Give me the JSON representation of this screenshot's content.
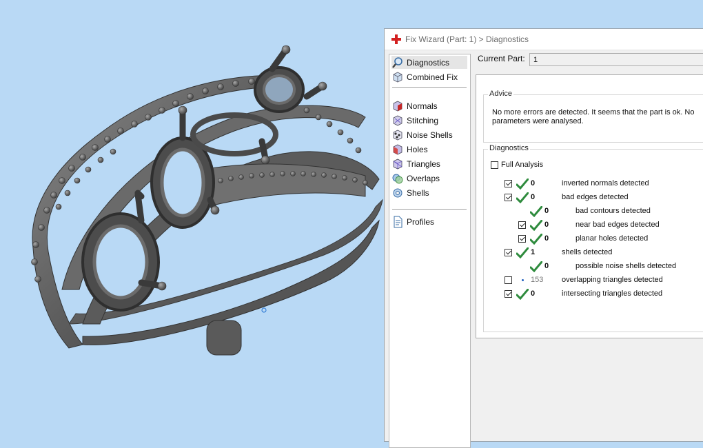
{
  "window": {
    "title": "Fix Wizard (Part: 1) > Diagnostics"
  },
  "nav": {
    "items": [
      {
        "label": "Diagnostics",
        "icon": "magnifier-icon",
        "selected": true
      },
      {
        "label": "Combined Fix",
        "icon": "cube-icon"
      },
      {
        "label": "Normals",
        "icon": "normals-cube-icon"
      },
      {
        "label": "Stitching",
        "icon": "stitching-cube-icon"
      },
      {
        "label": "Noise Shells",
        "icon": "noise-shells-icon"
      },
      {
        "label": "Holes",
        "icon": "holes-cube-icon"
      },
      {
        "label": "Triangles",
        "icon": "triangles-cube-icon"
      },
      {
        "label": "Overlaps",
        "icon": "overlaps-icon"
      },
      {
        "label": "Shells",
        "icon": "shells-icon"
      },
      {
        "label": "Profiles",
        "icon": "profiles-document-icon"
      }
    ]
  },
  "current_part": {
    "label": "Current Part:",
    "value": "1"
  },
  "advice": {
    "title": "Advice",
    "line1": "No more errors are detected. It seems that the part is ok. No",
    "line2": "parameters were analysed."
  },
  "diagnostics": {
    "title": "Diagnostics",
    "full_analysis_label": "Full Analysis",
    "full_analysis_checked": false,
    "rows": [
      {
        "checkbox": true,
        "checked": true,
        "status": "ok",
        "count": "0",
        "label": "inverted normals detected",
        "indent": 0
      },
      {
        "checkbox": true,
        "checked": true,
        "status": "ok",
        "count": "0",
        "label": "bad edges detected",
        "indent": 0
      },
      {
        "checkbox": false,
        "checked": false,
        "status": "ok",
        "count": "0",
        "label": "bad contours detected",
        "indent": 1
      },
      {
        "checkbox": true,
        "checked": true,
        "status": "ok",
        "count": "0",
        "label": "near bad edges detected",
        "indent": 1
      },
      {
        "checkbox": true,
        "checked": true,
        "status": "ok",
        "count": "0",
        "label": "planar holes detected",
        "indent": 1
      },
      {
        "checkbox": true,
        "checked": true,
        "status": "ok",
        "count": "1",
        "label": "shells detected",
        "indent": 0
      },
      {
        "checkbox": false,
        "checked": false,
        "status": "ok",
        "count": "0",
        "label": "possible noise shells detected",
        "indent": 1
      },
      {
        "checkbox": true,
        "checked": false,
        "status": "not-run",
        "count": "153",
        "label": "overlapping triangles detected",
        "indent": 0
      },
      {
        "checkbox": true,
        "checked": true,
        "status": "ok",
        "count": "0",
        "label": "intersecting triangles detected",
        "indent": 0
      }
    ]
  },
  "colors": {
    "viewport_bg": "#b9d9f5",
    "ok_tick": "#2e8b3d",
    "title_cross": "#d32020"
  }
}
